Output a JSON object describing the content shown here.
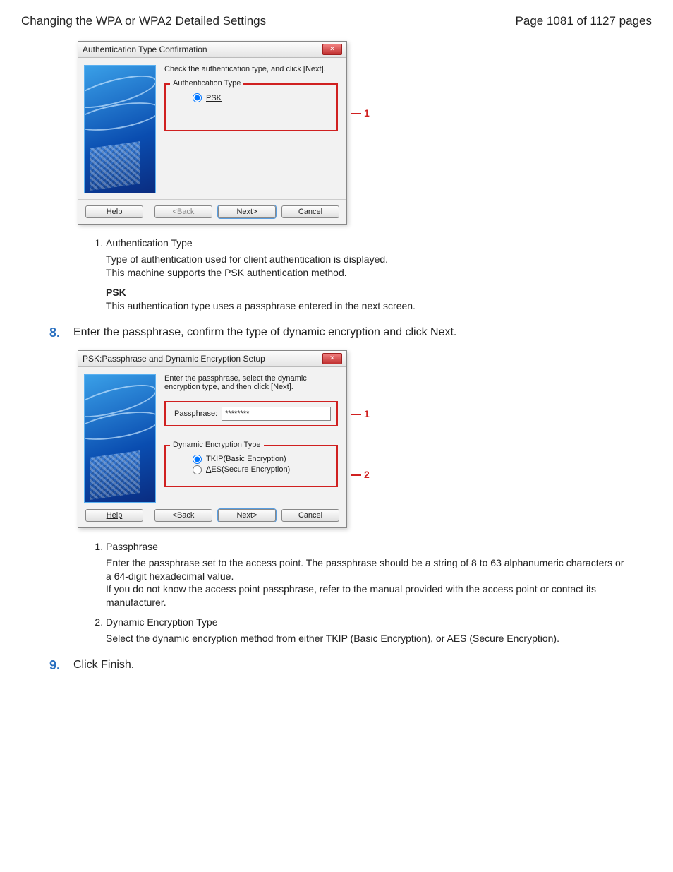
{
  "header": {
    "title": "Changing the WPA or WPA2 Detailed Settings",
    "page_indicator": "Page 1081 of 1127 pages"
  },
  "dialog1": {
    "title": "Authentication Type Confirmation",
    "instruction": "Check the authentication type, and click [Next].",
    "group_label": "Authentication Type",
    "psk_label": "PSK",
    "buttons": {
      "help": "Help",
      "back": "<Back",
      "next": "Next>",
      "cancel": "Cancel"
    },
    "callout_1": "1"
  },
  "explain1": {
    "item1_title": "Authentication Type",
    "item1_body_a": "Type of authentication used for client authentication is displayed.",
    "item1_body_b": "This machine supports the PSK authentication method.",
    "psk_heading": "PSK",
    "psk_body": "This authentication type uses a passphrase entered in the next screen."
  },
  "step8": {
    "num": "8.",
    "text": "Enter the passphrase, confirm the type of dynamic encryption and click Next."
  },
  "dialog2": {
    "title": "PSK:Passphrase and Dynamic Encryption Setup",
    "instruction": "Enter the passphrase, select the dynamic encryption type, and then click [Next].",
    "passphrase_label": "Passphrase:",
    "passphrase_value": "********",
    "group_label": "Dynamic Encryption Type",
    "tkip_label": "TKIP(Basic Encryption)",
    "aes_label": "AES(Secure Encryption)",
    "buttons": {
      "help": "Help",
      "back": "<Back",
      "next": "Next>",
      "cancel": "Cancel"
    },
    "callout_1": "1",
    "callout_2": "2"
  },
  "explain2": {
    "item1_title": "Passphrase",
    "item1_body_a": "Enter the passphrase set to the access point. The passphrase should be a string of 8 to 63 alphanumeric characters or a 64-digit hexadecimal value.",
    "item1_body_b": "If you do not know the access point passphrase, refer to the manual provided with the access point or contact its manufacturer.",
    "item2_title": "Dynamic Encryption Type",
    "item2_body": "Select the dynamic encryption method from either TKIP (Basic Encryption), or AES (Secure Encryption)."
  },
  "step9": {
    "num": "9.",
    "text": "Click Finish."
  }
}
